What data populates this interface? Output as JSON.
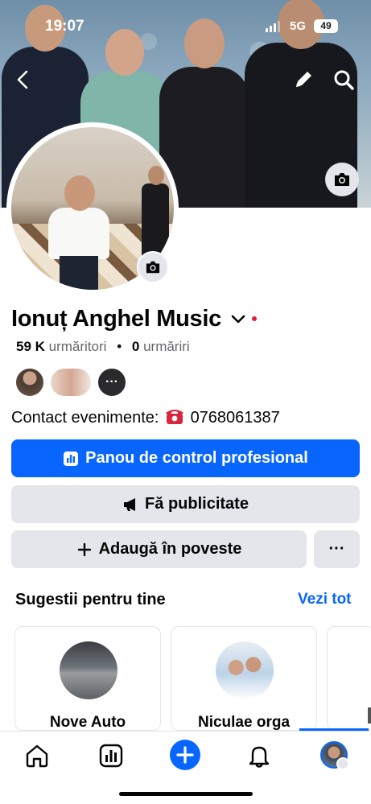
{
  "status_bar": {
    "time": "19:07",
    "network": "5G",
    "battery": "49"
  },
  "profile": {
    "name": "Ionuț Anghel Music",
    "followers_count": "59 K",
    "followers_label": "urmăritori",
    "separator": "•",
    "following_count": "0",
    "following_label": "urmăriri",
    "more_friends": "···",
    "contact_label": "Contact evenimente:",
    "contact_phone": "0768061387"
  },
  "actions": {
    "dashboard": "Panou de control profesional",
    "advertise": "Fă publicitate",
    "add_story": "Adaugă în poveste",
    "more": "···"
  },
  "suggestions": {
    "title": "Sugestii pentru tine",
    "see_all": "Vezi tot",
    "cards": [
      {
        "name": "Nove Auto"
      },
      {
        "name": "Niculae orga"
      }
    ]
  },
  "icons": {
    "back": "chevron-left-icon",
    "edit": "pencil-icon",
    "search": "search-icon",
    "camera": "camera-icon",
    "home": "home-icon",
    "dashboard": "bar-chart-icon",
    "create": "plus-icon",
    "notifications": "bell-icon",
    "megaphone": "megaphone-icon",
    "phone": "telephone-icon"
  },
  "colors": {
    "accent": "#0866ff",
    "button_grey": "#e4e6eb",
    "text_secondary": "#65676b",
    "notification_dot": "#e41e3f"
  }
}
